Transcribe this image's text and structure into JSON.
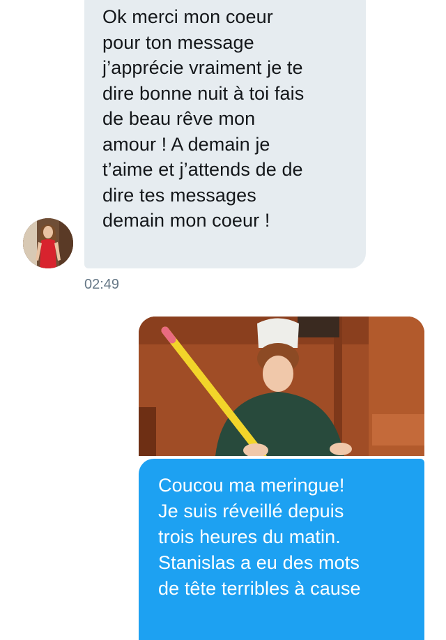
{
  "conversation": {
    "incoming_message": {
      "text": "Ok merci mon coeur\npour ton message\nj’apprécie vraiment je te\ndire bonne nuit à toi fais\nde beau rêve mon\namour ! A demain je\nt’aime et j’attends de de\ndire tes messages\ndemain mon coeur !",
      "timestamp": "02:49"
    },
    "outgoing_message": {
      "text": "Coucou ma meringue!\nJe suis réveillé depuis\ntrois heures du matin.\nStanislas a eu des mots\nde tête terribles à cause"
    }
  },
  "colors": {
    "incoming_bubble": "#e6ecf0",
    "outgoing_bubble": "#1da1f2",
    "timestamp": "#657786"
  }
}
